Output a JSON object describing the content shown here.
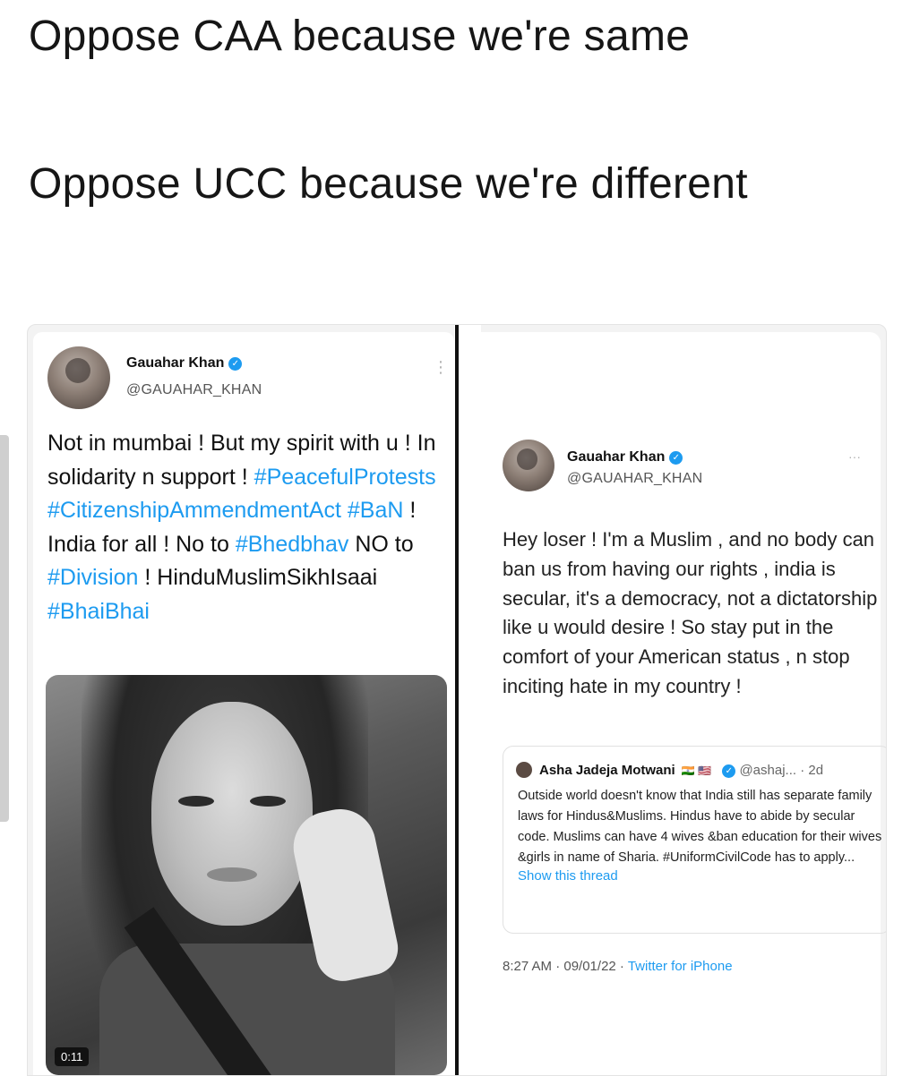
{
  "caption": {
    "line1": "Oppose CAA because we're same",
    "line2": "Oppose UCC because we're different"
  },
  "left_tweet": {
    "name": "Gauahar Khan",
    "handle": "@GAUAHAR_KHAN",
    "text_1": "Not in mumbai ! But my spirit with u ! In solidarity n support !",
    "tag_1": "#PeacefulProtests",
    "tag_2": "#CitizenshipAmmendmentAct",
    "tag_3": "#BaN",
    "text_2": "! India for all ! No to",
    "tag_4": "#Bhedbhav",
    "text_3": "NO to",
    "tag_5": "#Division",
    "text_4": "!",
    "text_5": "HinduMuslimSikhIsaai",
    "tag_6": "#BhaiBhai",
    "video_time": "0:11"
  },
  "right_tweet": {
    "name": "Gauahar Khan",
    "handle": "@GAUAHAR_KHAN",
    "text": "Hey loser ! I'm a Muslim , and no body can ban us from having our rights , india is secular, it's a democracy, not a dictatorship like u would desire ! So stay put in the comfort of your American status , n stop inciting hate in my country !",
    "quote": {
      "name": "Asha Jadeja Motwani",
      "flags": "🇮🇳 🇺🇸",
      "handle_time": "@ashaj... · 2d",
      "text": "Outside world doesn't know that India still has separate family laws for Hindus&Muslims. Hindus have to abide by secular code. Muslims can have 4 wives &ban education for their wives &girls in name of Sharia. #UniformCivilCode has to apply...",
      "link": "Show this thread"
    },
    "timestamp": "8:27 AM · 09/01/22 · ",
    "source": "Twitter for iPhone"
  },
  "icons": {
    "verified": "✓",
    "menu_vertical": "⋮",
    "menu_horizontal": "···"
  },
  "colors": {
    "link": "#1d9bf0"
  }
}
